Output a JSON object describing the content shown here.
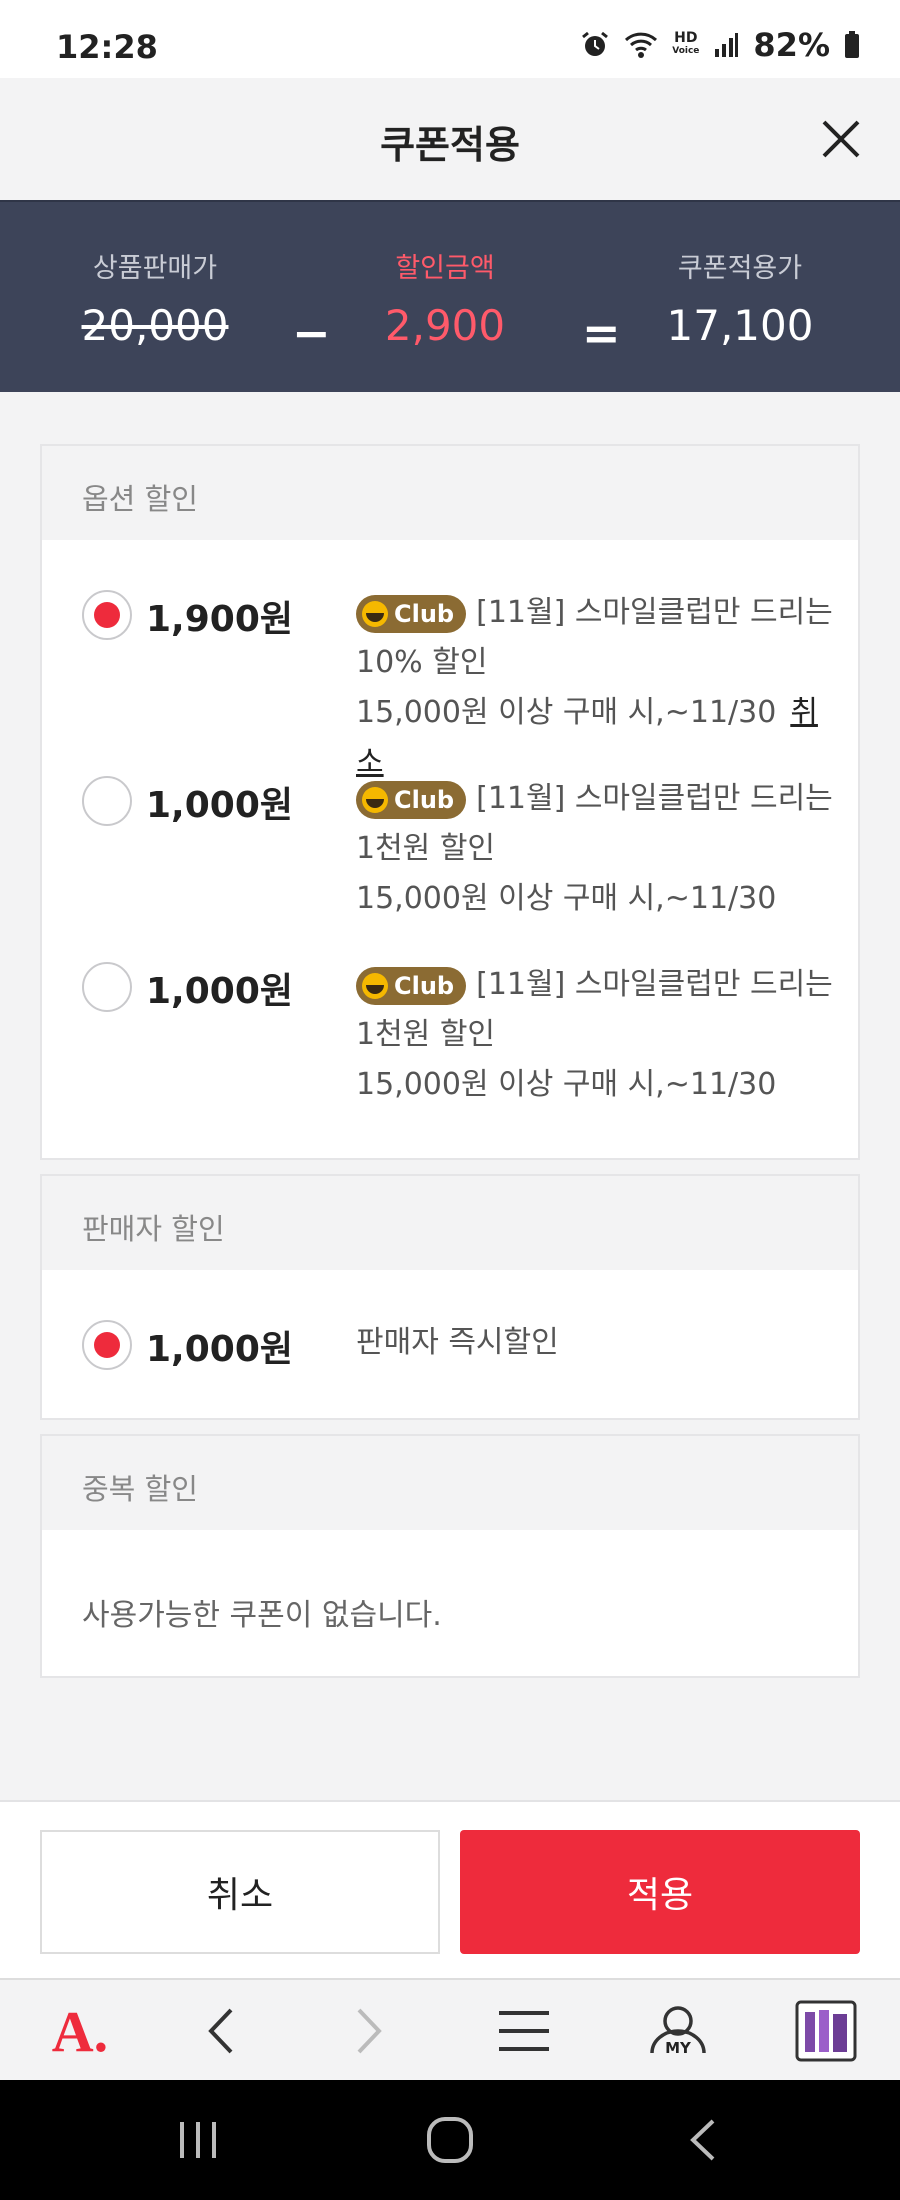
{
  "status_bar": {
    "time": "12:28",
    "hd_top": "HD",
    "hd_bottom": "Voice",
    "battery": "82%"
  },
  "header": {
    "title": "쿠폰적용"
  },
  "summary": {
    "original_label": "상품판매가",
    "original_value": "20,000",
    "minus": "−",
    "discount_label": "할인금액",
    "discount_value": "2,900",
    "equals": "=",
    "final_label": "쿠폰적용가",
    "final_value": "17,100"
  },
  "option_section": {
    "title": "옵션 할인",
    "coupons": [
      {
        "amount": "1,900원",
        "selected": true,
        "badge": "Club",
        "line1": "[11월] 스마일클럽만 드리는 10% 할인",
        "line2": "15,000원 이상 구매 시,~11/30",
        "cancel": "취소"
      },
      {
        "amount": "1,000원",
        "selected": false,
        "badge": "Club",
        "line1": "[11월] 스마일클럽만 드리는 1천원 할인",
        "line2": "15,000원 이상 구매 시,~11/30"
      },
      {
        "amount": "1,000원",
        "selected": false,
        "badge": "Club",
        "line1": "[11월] 스마일클럽만 드리는 1천원 할인",
        "line2": "15,000원 이상 구매 시,~11/30"
      }
    ]
  },
  "seller_section": {
    "title": "판매자 할인",
    "coupon": {
      "amount": "1,000원",
      "selected": true,
      "desc": "판매자 즉시할인"
    }
  },
  "duplicate_section": {
    "title": "중복 할인",
    "empty": "사용가능한 쿠폰이 없습니다."
  },
  "buttons": {
    "cancel": "취소",
    "apply": "적용"
  },
  "browser_nav": {
    "logo": "A.",
    "my": "MY"
  },
  "colors": {
    "accent": "#ee2b3c",
    "summary_bg": "#3d4459",
    "club_badge": "#8b6b33"
  }
}
